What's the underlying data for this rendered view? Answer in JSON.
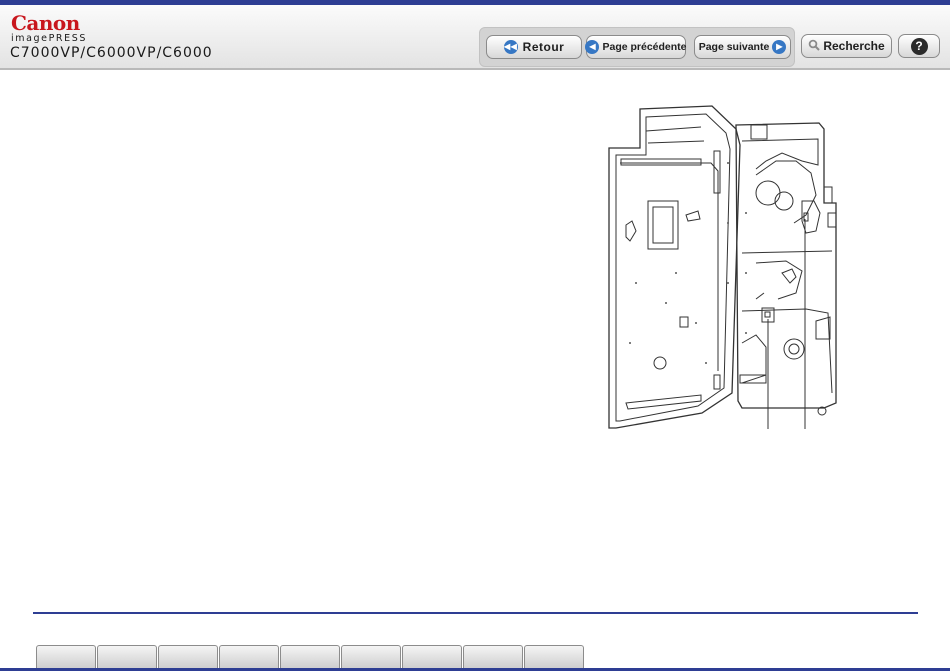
{
  "header": {
    "brand": "Canon",
    "product": "imagePRESS",
    "model": "C7000VP/C6000VP/C6000"
  },
  "toolbar": {
    "back_label": "Retour",
    "prev_label": "Page précédente",
    "next_label": "Page suivante",
    "search_label": "Recherche",
    "help_label": "?"
  },
  "icons": {
    "back": "double-chevron-left-icon",
    "prev": "chevron-left-icon",
    "next": "chevron-right-icon",
    "search": "magnifier-icon",
    "help": "question-icon"
  },
  "footer": {
    "tab_count": 9
  },
  "colors": {
    "accent": "#2e3e93",
    "brand": "#c8161d",
    "button_icon": "#3677c4"
  }
}
